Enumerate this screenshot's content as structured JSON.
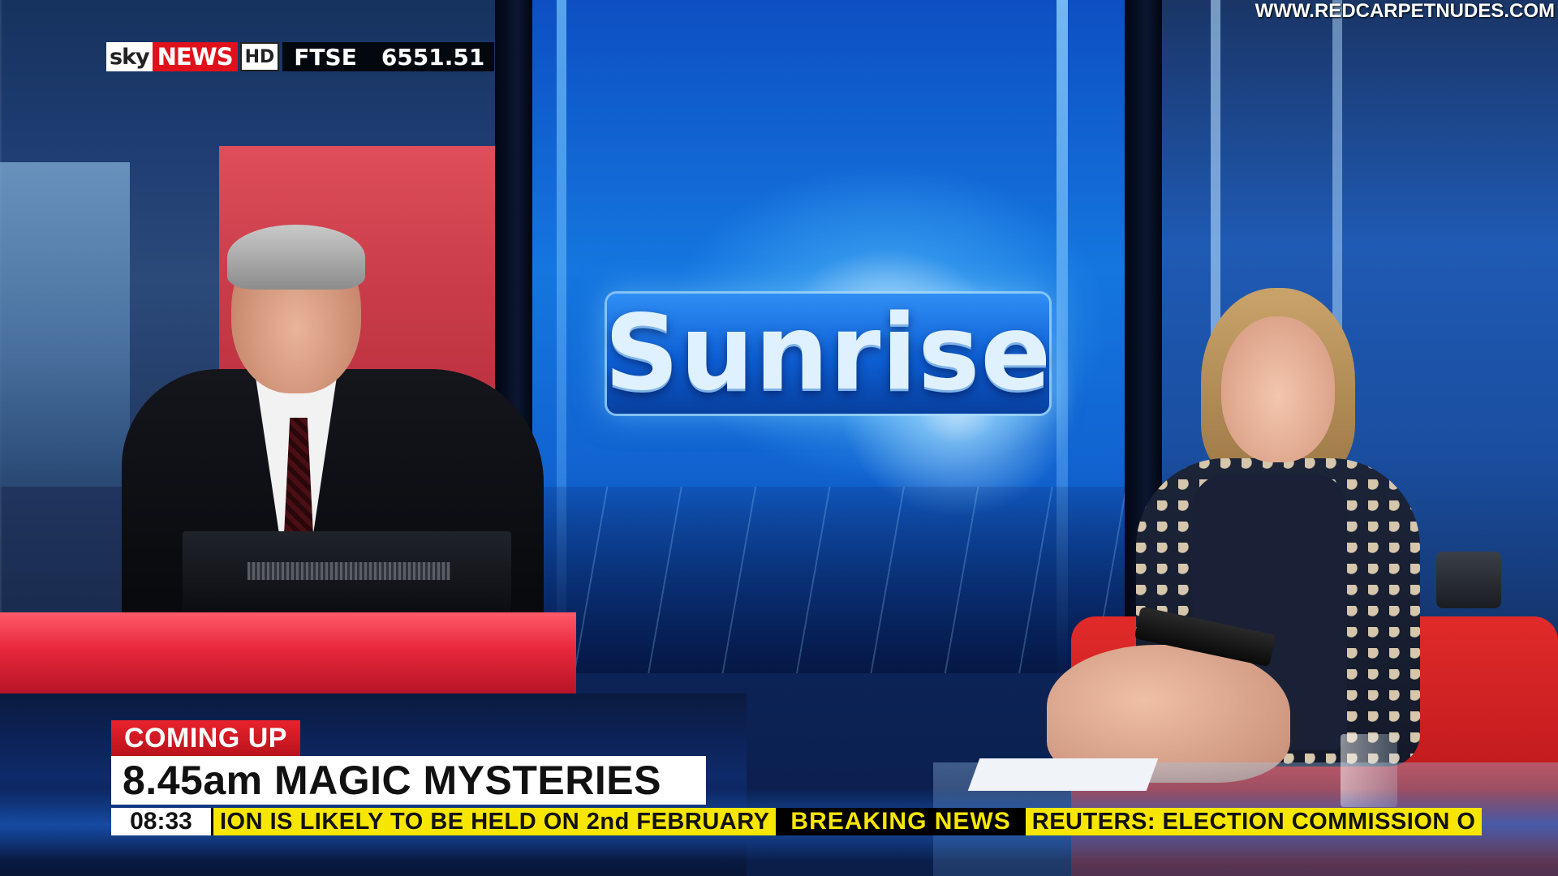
{
  "channel": {
    "logo_sky": "sky",
    "logo_news": "NEWS",
    "logo_hd": "HD",
    "market_label": "FTSE",
    "market_value": "6551.51"
  },
  "watermark": "WWW.REDCARPETNUDES.COM",
  "set": {
    "show_title": "Sunrise"
  },
  "strap": {
    "coming_up_label": "COMING UP",
    "headline": "8.45am MAGIC MYSTERIES",
    "clock": "08:33",
    "ticker_items": [
      "ION IS LIKELY TO BE HELD ON 2nd FEBRUARY",
      "BREAKING NEWS",
      "REUTERS: ELECTION COMMISSION O"
    ]
  },
  "colors": {
    "sky_red": "#e0111b",
    "ticker_yellow": "#f7e600",
    "set_blue": "#1576e0"
  }
}
